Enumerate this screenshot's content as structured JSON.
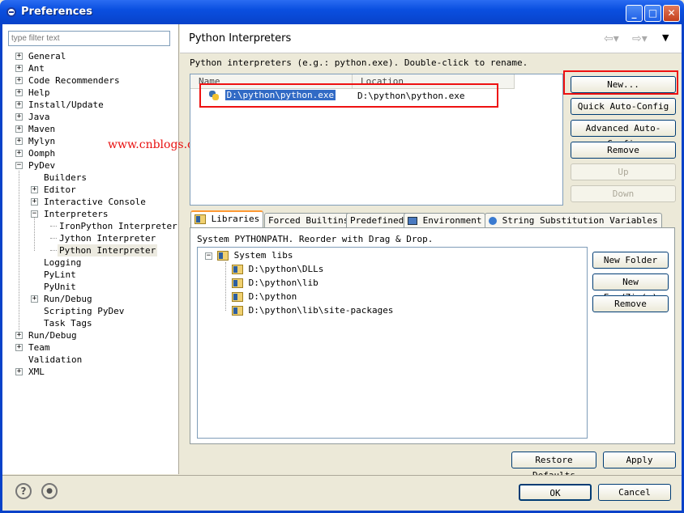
{
  "window": {
    "title": "Preferences"
  },
  "filter": {
    "placeholder": "type filter text"
  },
  "tree": {
    "general": "General",
    "ant": "Ant",
    "code_recommenders": "Code Recommenders",
    "help": "Help",
    "install_update": "Install/Update",
    "java": "Java",
    "maven": "Maven",
    "mylyn": "Mylyn",
    "oomph": "Oomph",
    "pydev": "PyDev",
    "builders": "Builders",
    "editor": "Editor",
    "interactive_console": "Interactive Console",
    "interpreters": "Interpreters",
    "ironpython": "IronPython Interpreter",
    "jython": "Jython Interpreter",
    "python": "Python Interpreter",
    "logging": "Logging",
    "pylint": "PyLint",
    "pyunit": "PyUnit",
    "pydev_run_debug": "Run/Debug",
    "scripting": "Scripting PyDev",
    "task_tags": "Task Tags",
    "run_debug": "Run/Debug",
    "team": "Team",
    "validation": "Validation",
    "xml": "XML"
  },
  "watermark": "www.cnblogs.com/dinghanhua",
  "page": {
    "title": "Python Interpreters",
    "description": "Python interpreters (e.g.: python.exe).   Double-click to rename."
  },
  "interpreters_table": {
    "col_name": "Name",
    "col_location": "Location",
    "row_name": "D:\\python\\python.exe",
    "row_location": "D:\\python\\python.exe"
  },
  "buttons": {
    "new": "New...",
    "quick_auto_config": "Quick Auto-Config",
    "advanced_auto_config": "Advanced Auto-Config",
    "remove": "Remove",
    "up": "Up",
    "down": "Down",
    "new_folder": "New Folder",
    "new_egg_zip": "New Egg/Zip(s)",
    "remove_lib": "Remove",
    "restore_defaults": "Restore Defaults",
    "apply": "Apply",
    "ok": "OK",
    "cancel": "Cancel"
  },
  "tabs": {
    "libraries": "Libraries",
    "forced_builtins": "Forced Builtins",
    "predefined": "Predefined",
    "environment": "Environment",
    "string_substitution": "String Substitution Variables"
  },
  "libraries": {
    "description": "System PYTHONPATH.   Reorder with Drag & Drop.",
    "root": "System libs",
    "items": [
      "D:\\python\\DLLs",
      "D:\\python\\lib",
      "D:\\python",
      "D:\\python\\lib\\site-packages"
    ]
  },
  "icons": {
    "help": "?",
    "record": "●"
  },
  "colors": {
    "titlebar": "#0a4fe0",
    "highlight_box": "#ee1111",
    "watermark": "#e81010"
  }
}
